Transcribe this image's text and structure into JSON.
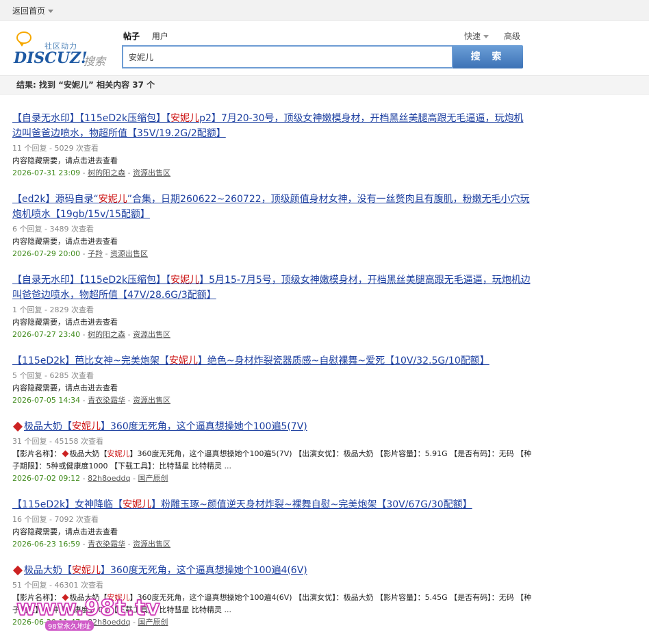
{
  "topbar": {
    "home_label": "返回首页"
  },
  "header": {
    "logo_tagline": "社区动力",
    "logo_word": "DISCUZ!",
    "logo_search": "搜索",
    "tabs": [
      {
        "label": "帖子"
      },
      {
        "label": "用户"
      }
    ],
    "quick_label": "快速",
    "advanced_label": "高级",
    "search_value": "安妮儿",
    "search_button": "搜 索"
  },
  "summary": {
    "text": "结果: 找到 “安妮儿” 相关内容 37 个"
  },
  "results": [
    {
      "title_a": "【自录无水印】【115eD2k压缩包】【",
      "title_hl": "安妮儿",
      "title_b": "p2】7月20-30号，顶级女神嫩模身材，开档黑丝美腿高跟无毛逼逼，玩炮机边叫爸爸边喷水，物超所值【35V/19.2G/2配额】",
      "stats": "11 个回复 - 5029 次查看",
      "desc": "内容隐藏需要，请点击进去查看",
      "date": "2026-07-31 23:09",
      "author": "树的阳之森",
      "forum": "资源出售区"
    },
    {
      "title_a": "【ed2k】源码自录“",
      "title_hl": "安妮儿",
      "title_b": "”合集，日期260622~260722，顶级颜值身材女神，没有一丝赘肉且有腹肌，粉嫩无毛小穴玩炮机喷水【19gb/15v/15配额】",
      "stats": "6 个回复 - 3489 次查看",
      "desc": "内容隐藏需要，请点击进去查看",
      "date": "2026-07-29 20:00",
      "author": "子羚",
      "forum": "资源出售区"
    },
    {
      "title_a": "【自录无水印】【115eD2k压缩包】【",
      "title_hl": "安妮儿",
      "title_b": "】5月15-7月5号，顶级女神嫩模身材，开档黑丝美腿高跟无毛逼逼，玩炮机边叫爸爸边喷水，物超所值【47V/28.6G/3配额】",
      "stats": "1 个回复 - 2829 次查看",
      "desc": "内容隐藏需要，请点击进去查看",
      "date": "2026-07-27 23:40",
      "author": "树的阳之森",
      "forum": "资源出售区"
    },
    {
      "title_a": "【115eD2k】芭比女神~完美炮架【",
      "title_hl": "安妮儿",
      "title_b": "】绝色~身材炸裂瓷器质感~自慰裸舞~爱死【10V/32.5G/10配额】",
      "stats": "5 个回复 - 6285 次查看",
      "desc": "内容隐藏需要，请点击进去查看",
      "date": "2026-07-05 14:34",
      "author": "青衣染霜华",
      "forum": "资源出售区"
    },
    {
      "diamond": true,
      "title_a": "极品大奶【",
      "title_hl": "安妮儿",
      "title_b": "】360度无死角，这个逼真想操她个100遍5(7V)",
      "stats": "31 个回复 - 45158 次查看",
      "desc_a": "【影片名称】：",
      "desc_b": "极品大奶【",
      "desc_hl": "安妮儿",
      "desc_c": "】360度无死角，这个逼真想操她个100遍5(7V) 【出演女优】：极品大奶 【影片容量】：5.91G 【是否有码】：无码 【种子期限】：5种或健康度1000 【下载工具】：比特彗星 比特精灵 ...",
      "date": "2026-07-02 09:12",
      "author": "82h8oeddq",
      "forum": "国产原创"
    },
    {
      "title_a": "【115eD2k】女神降临【",
      "title_hl": "安妮儿",
      "title_b": "】粉雕玉琢~颜值逆天身材炸裂~裸舞自慰~完美炮架【30V/67G/30配额】",
      "stats": "16 个回复 - 7092 次查看",
      "desc": "内容隐藏需要，请点击进去查看",
      "date": "2026-06-23 16:59",
      "author": "青衣染霜华",
      "forum": "资源出售区"
    },
    {
      "diamond": true,
      "title_a": "极品大奶【",
      "title_hl": "安妮儿",
      "title_b": "】360度无死角，这个逼真想操她个100遍4(6V)",
      "stats": "51 个回复 - 46301 次查看",
      "desc_a": "【影片名称】：",
      "desc_b": "极品大奶【",
      "desc_hl": "安妮儿",
      "desc_c": "】360度无死角，这个逼真想操她个100遍4(6V) 【出演女优】：极品大奶 【影片容量】：5.45G 【是否有码】：无码 【种子期限】：5种或健康度1000 【下载工具】：比特彗星 比特精灵 ...",
      "date": "2026-06-20 11:47",
      "author": "82h8oeddq",
      "forum": "国产原创"
    }
  ],
  "watermark": {
    "text": "www.98t.tv",
    "sub": "98堂永久地址"
  }
}
